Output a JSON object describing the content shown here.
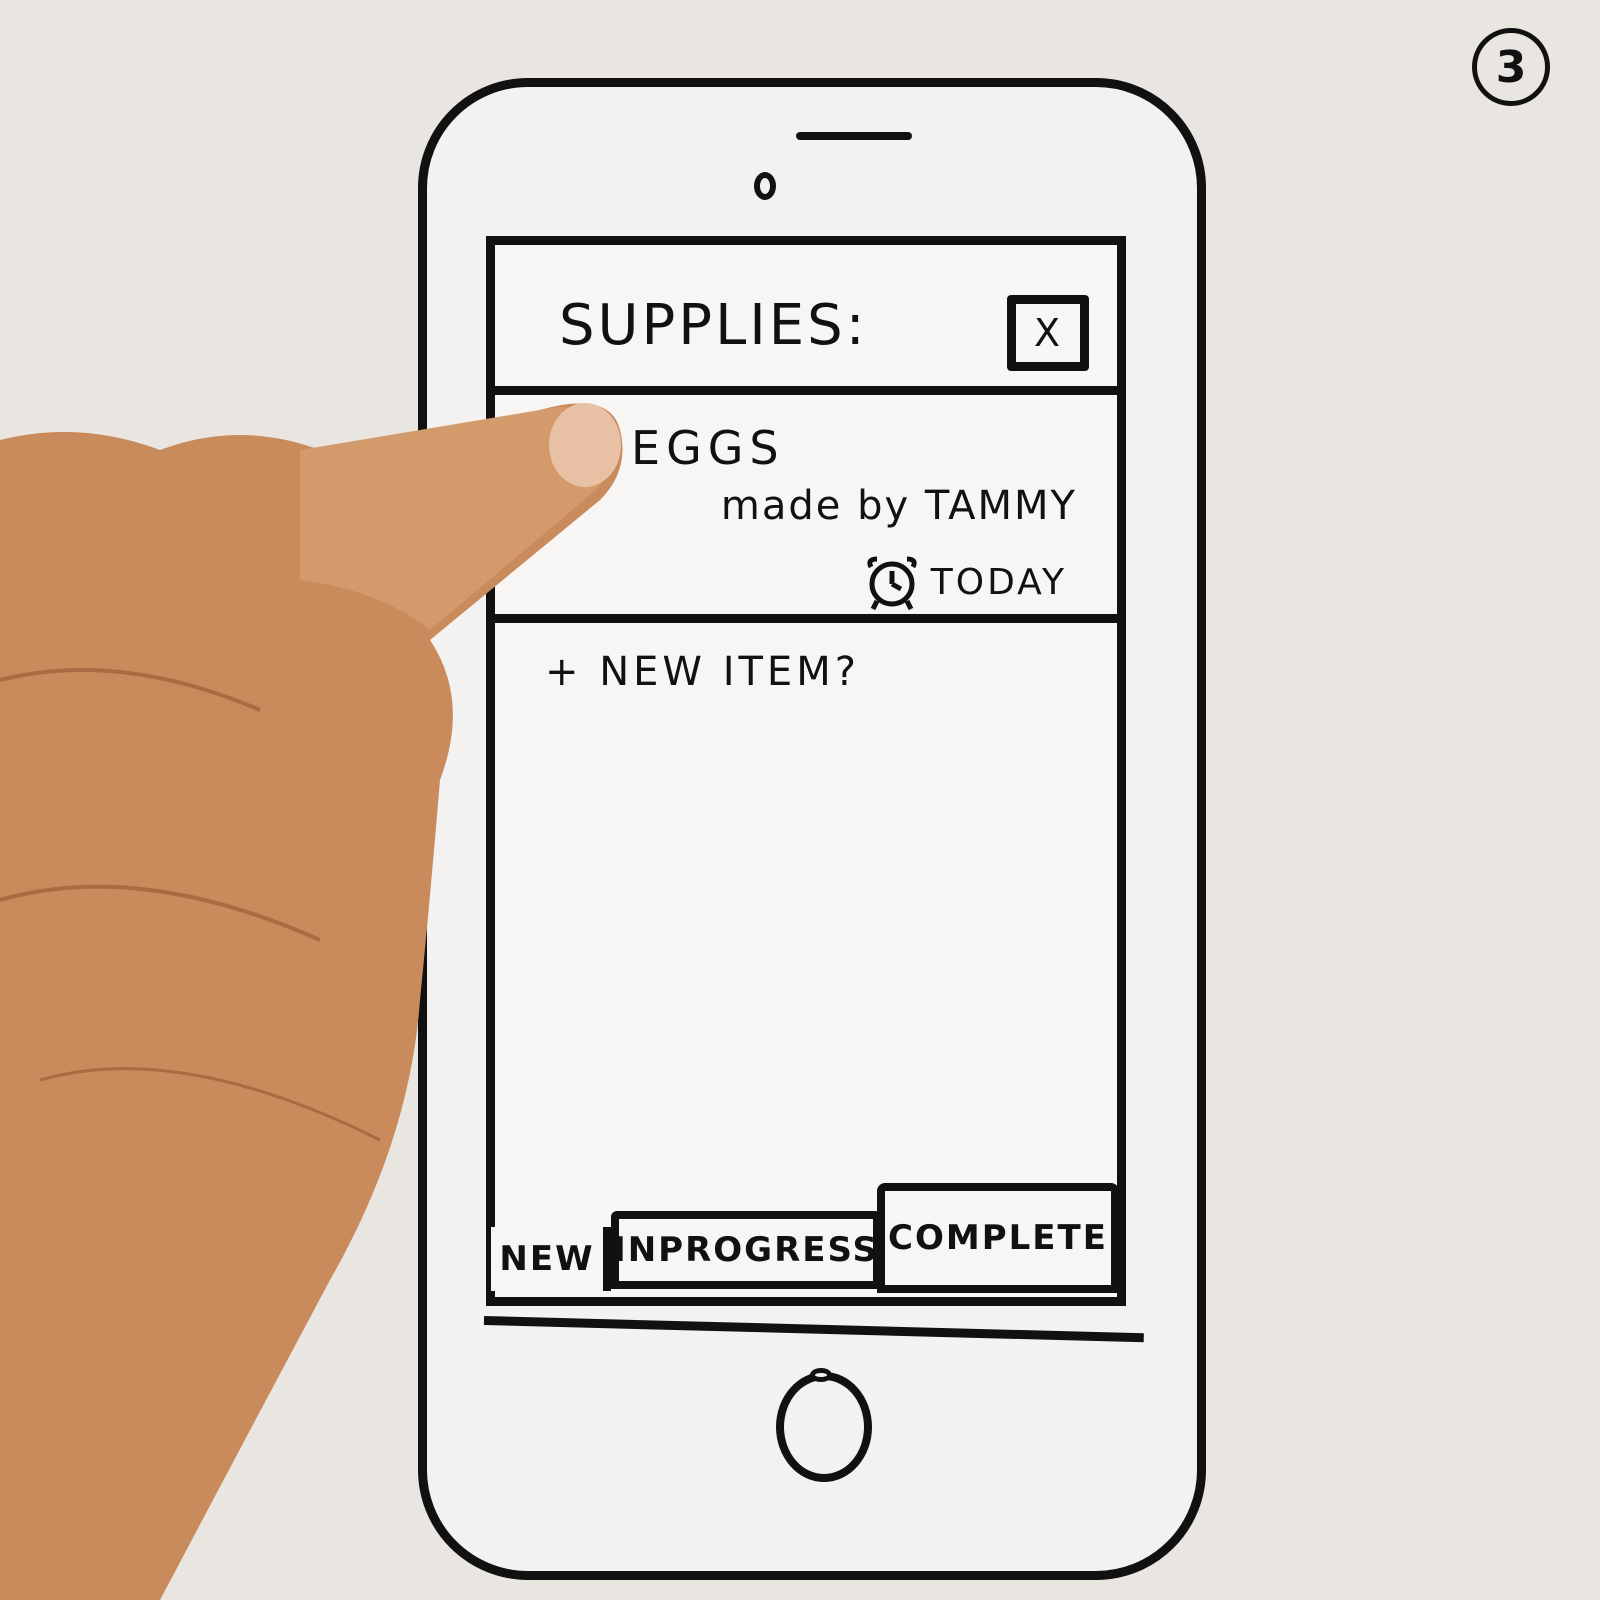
{
  "page_number": "3",
  "screen": {
    "title": "SUPPLIES:",
    "close_label": "X"
  },
  "item": {
    "name": "EGGS",
    "author": "made by TAMMY",
    "due_icon": "alarm-clock-icon",
    "due": "TODAY"
  },
  "new_item_label": "+ NEW ITEM?",
  "tabs": {
    "new": "NEW",
    "inprogress": "INPROGRESS",
    "complete": "COMPLETE"
  },
  "colors": {
    "ink": "#111111",
    "paper": "#f3f2f0",
    "background": "#e9e6e1",
    "skin": "#c98a5c"
  }
}
